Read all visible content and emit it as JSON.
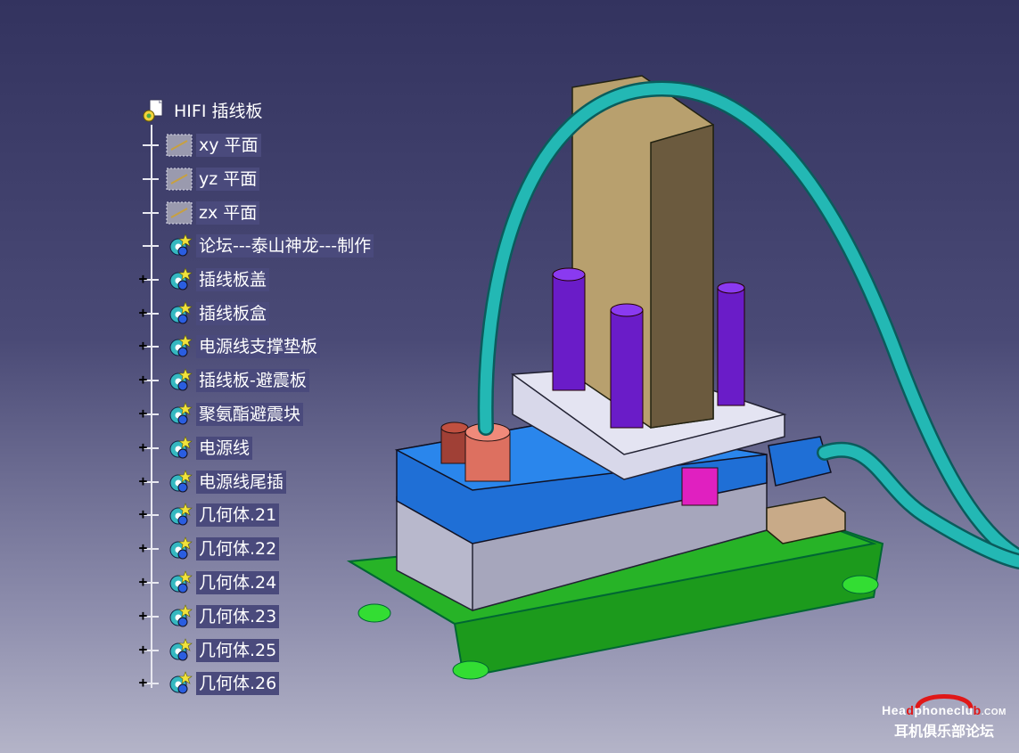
{
  "tree": {
    "root": {
      "label": "HIFI 插线板",
      "icon": "part-document-icon"
    },
    "planes": [
      {
        "label": "xy 平面",
        "icon": "plane-icon"
      },
      {
        "label": "yz 平面",
        "icon": "plane-icon"
      },
      {
        "label": "zx 平面",
        "icon": "plane-icon"
      }
    ],
    "bodies": [
      {
        "label": "论坛---泰山神龙---制作",
        "expandable": false
      },
      {
        "label": "插线板盖",
        "expandable": true
      },
      {
        "label": "插线板盒",
        "expandable": true
      },
      {
        "label": "电源线支撑垫板",
        "expandable": true
      },
      {
        "label": "插线板-避震板",
        "expandable": true
      },
      {
        "label": "聚氨酯避震块",
        "expandable": true
      },
      {
        "label": "电源线",
        "expandable": true
      },
      {
        "label": "电源线尾插",
        "expandable": true
      },
      {
        "label": "几何体.21",
        "expandable": true
      },
      {
        "label": "几何体.22",
        "expandable": true
      },
      {
        "label": "几何体.24",
        "expandable": true
      },
      {
        "label": "几何体.23",
        "expandable": true
      },
      {
        "label": "几何体.25",
        "expandable": true
      },
      {
        "label": "几何体.26",
        "expandable": true
      }
    ],
    "expander_symbol": "+"
  },
  "watermark": {
    "brand_pre": "Hea",
    "brand_d": "d",
    "brand_mid": "phoneclu",
    "brand_b": "b",
    "brand_suffix": ".COM",
    "cn_text": "耳机俱乐部论坛"
  },
  "colors": {
    "background_top": "#33335f",
    "background_bottom": "#b4b4c8",
    "label_bg": "#4a4a7c",
    "accent_red": "#e01818"
  }
}
